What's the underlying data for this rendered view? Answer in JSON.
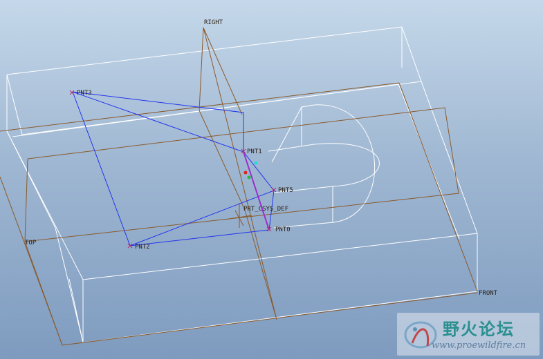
{
  "datum_planes": {
    "right": "RIGHT",
    "top": "TOP",
    "front": "FRONT"
  },
  "coordinate_system": "PRT_CSYS_DEF",
  "datum_points": [
    "PNT3",
    "PNT1",
    "PNT5",
    "PNT0",
    "PNT2"
  ],
  "watermark": {
    "title": "野火论坛",
    "url": "www.proewildfire.cn"
  },
  "colors": {
    "background_top": "#c5d8ea",
    "background_bottom": "#7e9bbf",
    "model_edges": "#ffffff",
    "datum_planes": "#8a5a2b",
    "sketch_curves": "#2233ee",
    "datum_point_marker": "#b03070"
  }
}
